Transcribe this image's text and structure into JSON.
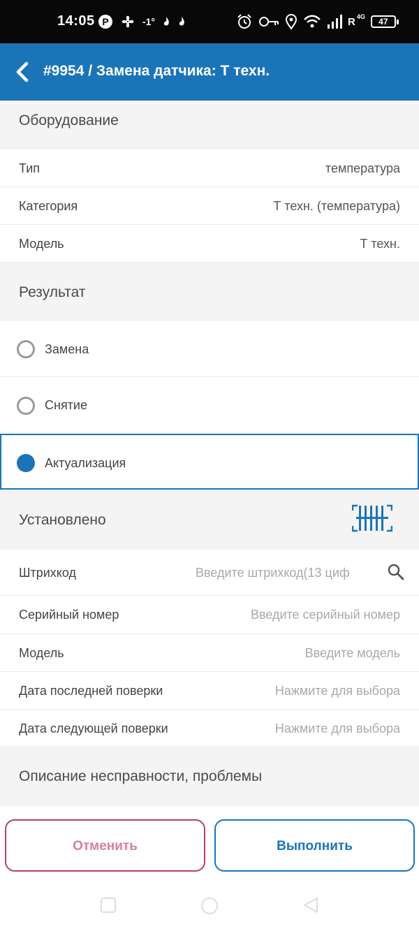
{
  "status_bar": {
    "time": "14:05",
    "temperature": "-1°",
    "network": "R",
    "network_type": "4G",
    "battery": "47"
  },
  "header": {
    "title": "#9954 / Замена датчика: Т техн."
  },
  "equipment": {
    "section_title": "Оборудование",
    "rows": [
      {
        "label": "Тип",
        "value": "температура"
      },
      {
        "label": "Категория",
        "value": "Т техн. (температура)"
      },
      {
        "label": "Модель",
        "value": "Т техн."
      }
    ]
  },
  "result": {
    "section_title": "Результат",
    "options": [
      {
        "label": "Замена",
        "selected": false
      },
      {
        "label": "Снятие",
        "selected": false
      },
      {
        "label": "Актуализация",
        "selected": true
      }
    ]
  },
  "installed": {
    "section_title": "Установлено",
    "fields": [
      {
        "label": "Штрихкод",
        "placeholder": "Введите штрихкод(13 циф"
      },
      {
        "label": "Серийный номер",
        "placeholder": "Введите серийный номер"
      },
      {
        "label": "Модель",
        "placeholder": "Введите модель"
      },
      {
        "label": "Дата последней поверки",
        "placeholder": "Нажмите для выбора"
      },
      {
        "label": "Дата следующей поверки",
        "placeholder": "Нажмите для выбора"
      }
    ]
  },
  "problem": {
    "section_title": "Описание несправности, проблемы"
  },
  "actions": {
    "cancel_label": "Отменить",
    "done_label": "Выполнить"
  },
  "colors": {
    "accent": "#1b74b8",
    "cancel": "#b54066",
    "background": "#f4f4f4"
  }
}
